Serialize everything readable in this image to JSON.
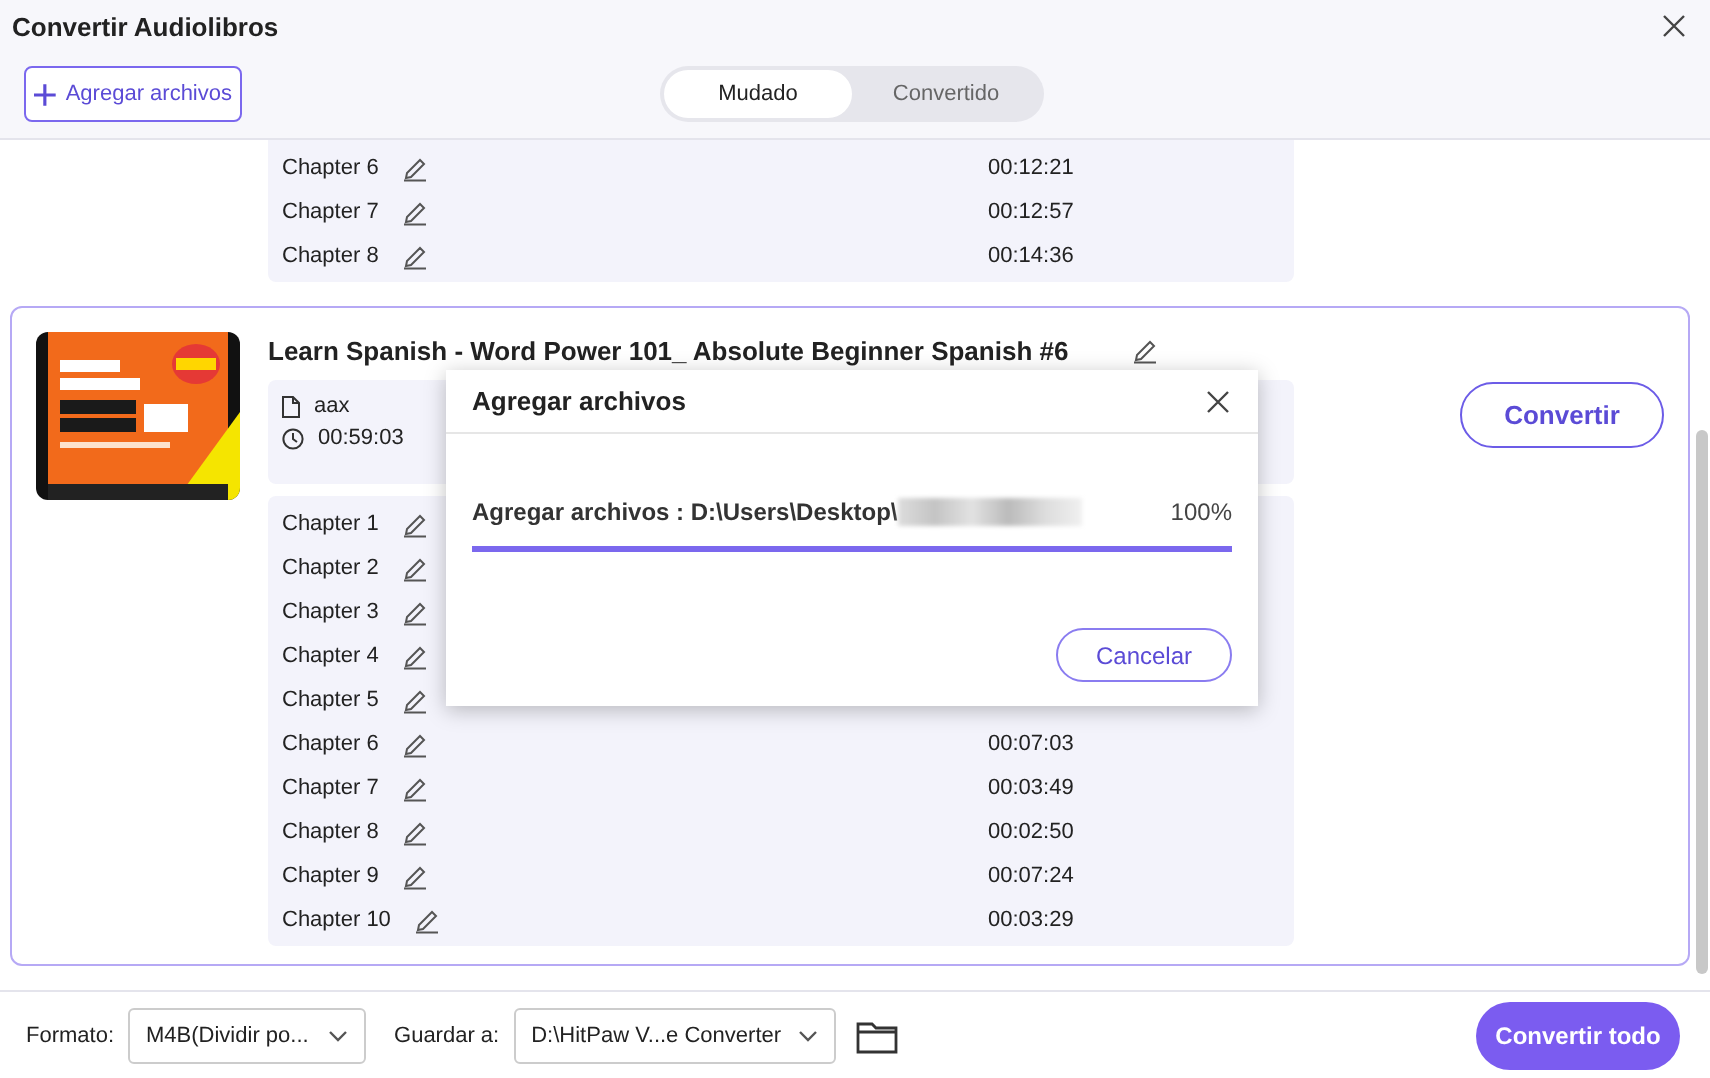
{
  "window": {
    "title": "Convertir Audiolibros"
  },
  "toolbar": {
    "add_button": "Agregar archivos"
  },
  "tabs": [
    {
      "label": "Mudado",
      "selected": true
    },
    {
      "label": "Convertido",
      "selected": false
    }
  ],
  "previous_book": {
    "chapters": [
      {
        "name": "Chapter 6",
        "duration": "00:12:21"
      },
      {
        "name": "Chapter 7",
        "duration": "00:12:57"
      },
      {
        "name": "Chapter 8",
        "duration": "00:14:36"
      }
    ]
  },
  "book": {
    "title": "Learn Spanish - Word Power 101_ Absolute Beginner Spanish #6",
    "format": "aax",
    "duration": "00:59:03",
    "convert_button": "Convertir",
    "selected": true,
    "chapters": [
      {
        "name": "Chapter 1"
      },
      {
        "name": "Chapter 2"
      },
      {
        "name": "Chapter 3"
      },
      {
        "name": "Chapter 4"
      },
      {
        "name": "Chapter 5"
      },
      {
        "name": "Chapter 6",
        "duration": "00:07:03"
      },
      {
        "name": "Chapter 7",
        "duration": "00:03:49"
      },
      {
        "name": "Chapter 8",
        "duration": "00:02:50"
      },
      {
        "name": "Chapter 9",
        "duration": "00:07:24"
      },
      {
        "name": "Chapter 10",
        "duration": "00:03:29"
      }
    ]
  },
  "footer": {
    "format_label": "Formato:",
    "format_value": "M4B(Dividir po...",
    "save_label": "Guardar a:",
    "save_value": "D:\\HitPaw V...e Converter",
    "convert_all_button": "Convertir todo"
  },
  "dialog": {
    "title": "Agregar archivos",
    "progress_label": "Agregar archivos : D:\\Users\\Desktop\\",
    "percent": "100%",
    "level": 1,
    "cancel_button": "Cancelar"
  }
}
